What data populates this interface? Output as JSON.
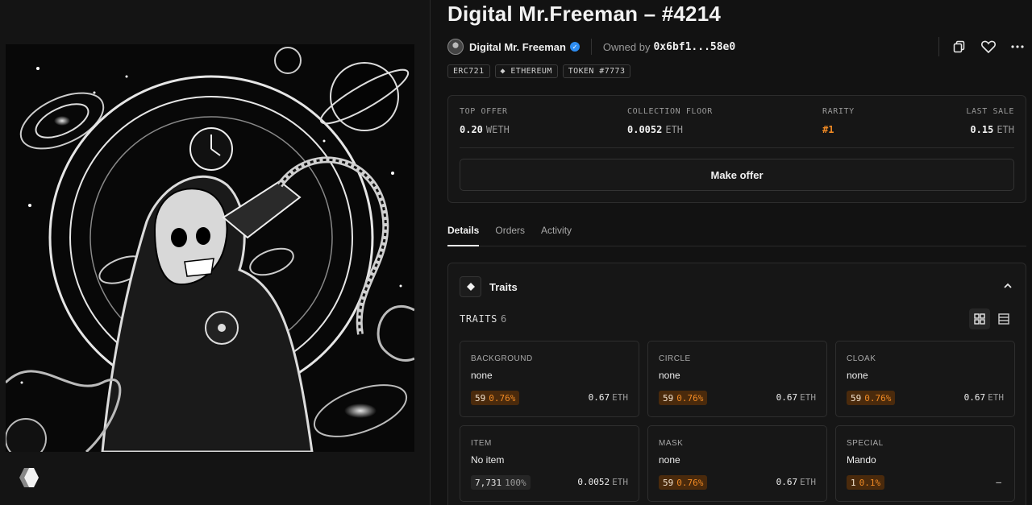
{
  "nft": {
    "title": "Digital Mr.Freeman – #4214",
    "creator": "Digital Mr. Freeman",
    "owned_label": "Owned by",
    "owner": "0x6bf1...58e0"
  },
  "tags": [
    "ERC721",
    "ETHEREUM",
    "TOKEN #7773"
  ],
  "stats": {
    "top_offer": {
      "label": "TOP OFFER",
      "value": "0.20",
      "unit": "WETH"
    },
    "floor": {
      "label": "COLLECTION FLOOR",
      "value": "0.0052",
      "unit": "ETH"
    },
    "rarity": {
      "label": "RARITY",
      "value": "#1"
    },
    "last_sale": {
      "label": "LAST SALE",
      "value": "0.15",
      "unit": "ETH"
    },
    "make_offer_label": "Make offer"
  },
  "tabs": [
    "Details",
    "Orders",
    "Activity"
  ],
  "traits": {
    "title": "Traits",
    "count_label": "TRAITS",
    "count": "6",
    "items": [
      {
        "type": "BACKGROUND",
        "value": "none",
        "count": "59",
        "pct": "0.76%",
        "price": "0.67",
        "unit": "ETH",
        "tier": "rare"
      },
      {
        "type": "CIRCLE",
        "value": "none",
        "count": "59",
        "pct": "0.76%",
        "price": "0.67",
        "unit": "ETH",
        "tier": "rare"
      },
      {
        "type": "CLOAK",
        "value": "none",
        "count": "59",
        "pct": "0.76%",
        "price": "0.67",
        "unit": "ETH",
        "tier": "rare"
      },
      {
        "type": "ITEM",
        "value": "No item",
        "count": "7,731",
        "pct": "100%",
        "price": "0.0052",
        "unit": "ETH",
        "tier": "common"
      },
      {
        "type": "MASK",
        "value": "none",
        "count": "59",
        "pct": "0.76%",
        "price": "0.67",
        "unit": "ETH",
        "tier": "rare"
      },
      {
        "type": "SPECIAL",
        "value": "Mando",
        "count": "1",
        "pct": "0.1%",
        "price": "–",
        "unit": "",
        "tier": "rare"
      }
    ]
  },
  "colors": {
    "accent_orange": "#f08a24",
    "verified_blue": "#2d8cf0",
    "background": "#121212"
  },
  "icons": [
    "copy-icon",
    "heart-icon",
    "more-icon",
    "diamond-icon",
    "chevron-up-icon",
    "grid-view-icon",
    "list-view-icon"
  ]
}
